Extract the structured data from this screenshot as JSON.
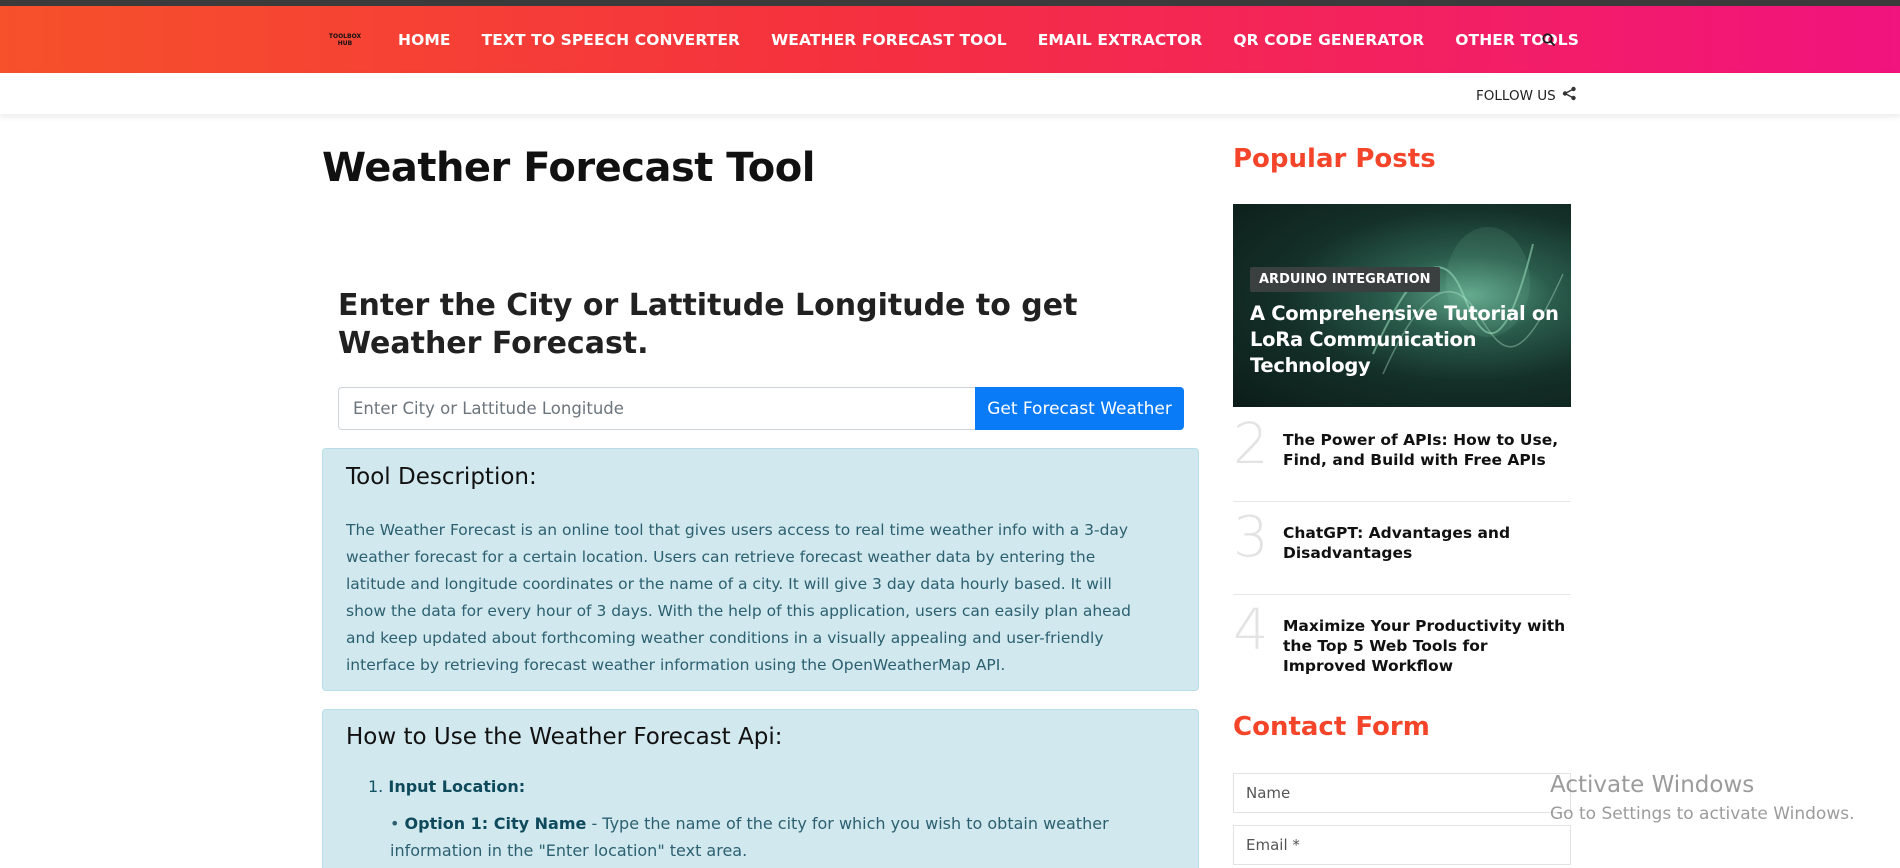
{
  "header": {
    "logo_line1": "TOOLBOX",
    "logo_line2": "HUB",
    "nav": [
      "HOME",
      "TEXT TO SPEECH CONVERTER",
      "WEATHER FORECAST TOOL",
      "EMAIL EXTRACTOR",
      "QR CODE GENERATOR",
      "OTHER TOOLS"
    ],
    "search_icon": "search-icon",
    "follow_label": "FOLLOW US",
    "share_icon": "share-icon"
  },
  "main": {
    "title": "Weather Forecast Tool",
    "form_heading": "Enter the City or Lattitude Longitude to get Weather Forecast.",
    "input_placeholder": "Enter City or Lattitude Longitude",
    "button_label": "Get Forecast Weather",
    "description_title": "Tool Description:",
    "description_text": "The Weather Forecast is an online tool that gives users access to real time weather info with a 3-day weather forecast for a certain location. Users can retrieve forecast weather data by entering the latitude and longitude coordinates or the name of a city. It will give 3 day data hourly based. It will show the data for every hour of 3 days. With the help of this application, users can easily plan ahead and keep updated about forthcoming weather conditions in a visually appealing and user-friendly interface by retrieving forecast weather information using the OpenWeatherMap API.",
    "howto_title": "How to Use the Weather Forecast Api:",
    "step1_num": "1.",
    "step1_label": "Input Location:",
    "option1_bullet": "•",
    "option1_label": "Option 1: City Name",
    "option1_text": " - Type the name of the city for which you wish to obtain weather information in the \"Enter location\" text area."
  },
  "sidebar": {
    "popular_heading": "Popular Posts",
    "feature_category": "ARDUINO INTEGRATION",
    "feature_title": "A Comprehensive Tutorial on LoRa Communication Technology",
    "posts": [
      {
        "num": "2",
        "title": "The Power of APIs: How to Use, Find, and Build with Free APIs"
      },
      {
        "num": "3",
        "title": "ChatGPT: Advantages and Disadvantages"
      },
      {
        "num": "4",
        "title": "Maximize Your Productivity with the Top 5 Web Tools for Improved Workflow"
      }
    ],
    "contact_heading": "Contact Form",
    "name_placeholder": "Name",
    "email_placeholder": "Email *"
  },
  "watermark": {
    "line1": "Activate Windows",
    "line2": "Go to Settings to activate Windows."
  },
  "colors": {
    "nav_gradient_start": "#f6512b",
    "nav_gradient_end": "#f1137e",
    "accent_heading": "#f4452a",
    "primary_button": "#0a7bf7",
    "info_box": "#d1e8ee"
  }
}
